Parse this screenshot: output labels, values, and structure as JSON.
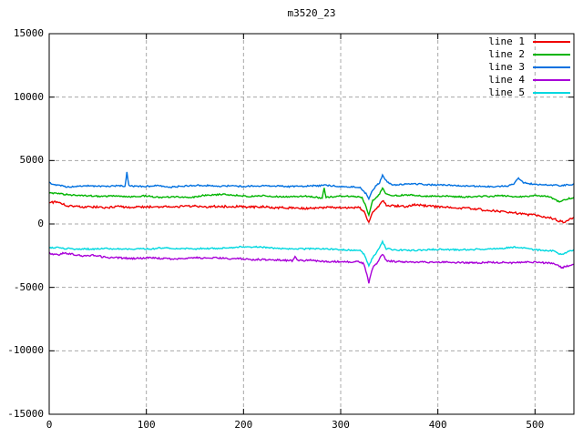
{
  "title": "m3520_23",
  "chart_data": {
    "type": "line",
    "title": "m3520_23",
    "xlabel": "",
    "ylabel": "",
    "xlim": [
      0,
      540
    ],
    "ylim": [
      -15000,
      15000
    ],
    "x_ticks": [
      0,
      100,
      200,
      300,
      400,
      500
    ],
    "x_tick_labels": [
      "0",
      "100",
      "200",
      "300",
      "400",
      "500"
    ],
    "y_ticks": [
      -15000,
      -10000,
      -5000,
      0,
      5000,
      10000,
      15000
    ],
    "y_tick_labels": [
      "-15000",
      "-10000",
      "-5000",
      "0",
      "5000",
      "10000",
      "15000"
    ],
    "grid": "dashed",
    "grid_color": "#a8a8a8",
    "border_color": "#000000",
    "background_color": "#ffffff",
    "legend_position": "top-right-inside",
    "series": [
      {
        "name": "line 1",
        "color": "#f00000",
        "noise": 110,
        "seed": 101,
        "anchors": [
          [
            0,
            1650
          ],
          [
            5,
            1750
          ],
          [
            9,
            1820
          ],
          [
            14,
            1600
          ],
          [
            20,
            1500
          ],
          [
            30,
            1420
          ],
          [
            40,
            1380
          ],
          [
            55,
            1350
          ],
          [
            70,
            1400
          ],
          [
            85,
            1380
          ],
          [
            100,
            1350
          ],
          [
            115,
            1400
          ],
          [
            130,
            1380
          ],
          [
            145,
            1420
          ],
          [
            160,
            1400
          ],
          [
            175,
            1450
          ],
          [
            190,
            1420
          ],
          [
            205,
            1380
          ],
          [
            220,
            1400
          ],
          [
            235,
            1350
          ],
          [
            250,
            1320
          ],
          [
            265,
            1300
          ],
          [
            280,
            1320
          ],
          [
            295,
            1350
          ],
          [
            310,
            1320
          ],
          [
            320,
            1280
          ],
          [
            325,
            900
          ],
          [
            329,
            100
          ],
          [
            333,
            1000
          ],
          [
            337,
            1250
          ],
          [
            340,
            1500
          ],
          [
            343,
            1900
          ],
          [
            347,
            1550
          ],
          [
            355,
            1450
          ],
          [
            365,
            1400
          ],
          [
            375,
            1450
          ],
          [
            385,
            1400
          ],
          [
            395,
            1350
          ],
          [
            405,
            1300
          ],
          [
            415,
            1250
          ],
          [
            425,
            1200
          ],
          [
            435,
            1150
          ],
          [
            445,
            1100
          ],
          [
            455,
            1050
          ],
          [
            465,
            1000
          ],
          [
            475,
            900
          ],
          [
            485,
            800
          ],
          [
            495,
            700
          ],
          [
            505,
            600
          ],
          [
            512,
            500
          ],
          [
            518,
            400
          ],
          [
            524,
            200
          ],
          [
            529,
            120
          ],
          [
            533,
            200
          ],
          [
            537,
            400
          ],
          [
            540,
            480
          ]
        ]
      },
      {
        "name": "line 2",
        "color": "#00b400",
        "noise": 70,
        "seed": 102,
        "anchors": [
          [
            0,
            2420
          ],
          [
            12,
            2350
          ],
          [
            25,
            2250
          ],
          [
            40,
            2200
          ],
          [
            55,
            2150
          ],
          [
            70,
            2200
          ],
          [
            85,
            2150
          ],
          [
            100,
            2220
          ],
          [
            115,
            2130
          ],
          [
            130,
            2180
          ],
          [
            145,
            2120
          ],
          [
            160,
            2250
          ],
          [
            175,
            2300
          ],
          [
            190,
            2250
          ],
          [
            205,
            2200
          ],
          [
            220,
            2250
          ],
          [
            235,
            2180
          ],
          [
            250,
            2150
          ],
          [
            265,
            2180
          ],
          [
            275,
            2100
          ],
          [
            281,
            2050
          ],
          [
            283,
            2880
          ],
          [
            285,
            2100
          ],
          [
            295,
            2180
          ],
          [
            305,
            2220
          ],
          [
            315,
            2150
          ],
          [
            322,
            2100
          ],
          [
            326,
            1400
          ],
          [
            329,
            700
          ],
          [
            333,
            1900
          ],
          [
            337,
            2100
          ],
          [
            340,
            2400
          ],
          [
            343,
            2850
          ],
          [
            347,
            2350
          ],
          [
            355,
            2250
          ],
          [
            365,
            2300
          ],
          [
            380,
            2250
          ],
          [
            395,
            2200
          ],
          [
            410,
            2180
          ],
          [
            425,
            2150
          ],
          [
            440,
            2200
          ],
          [
            455,
            2180
          ],
          [
            470,
            2220
          ],
          [
            480,
            2160
          ],
          [
            490,
            2200
          ],
          [
            500,
            2260
          ],
          [
            508,
            2220
          ],
          [
            515,
            2150
          ],
          [
            521,
            1900
          ],
          [
            526,
            1750
          ],
          [
            531,
            1950
          ],
          [
            536,
            2050
          ],
          [
            540,
            2100
          ]
        ]
      },
      {
        "name": "line 3",
        "color": "#0070e0",
        "noise": 70,
        "seed": 103,
        "anchors": [
          [
            0,
            3250
          ],
          [
            8,
            3100
          ],
          [
            20,
            2950
          ],
          [
            35,
            3050
          ],
          [
            50,
            2980
          ],
          [
            65,
            3000
          ],
          [
            78,
            3000
          ],
          [
            80,
            4100
          ],
          [
            82,
            3050
          ],
          [
            95,
            2980
          ],
          [
            110,
            3050
          ],
          [
            125,
            2900
          ],
          [
            140,
            3000
          ],
          [
            155,
            3050
          ],
          [
            170,
            2980
          ],
          [
            185,
            3020
          ],
          [
            200,
            3000
          ],
          [
            215,
            2960
          ],
          [
            230,
            3010
          ],
          [
            245,
            2950
          ],
          [
            260,
            3000
          ],
          [
            275,
            3040
          ],
          [
            283,
            3080
          ],
          [
            295,
            3000
          ],
          [
            310,
            2960
          ],
          [
            320,
            2870
          ],
          [
            326,
            2400
          ],
          [
            329,
            1950
          ],
          [
            332,
            2600
          ],
          [
            336,
            3000
          ],
          [
            340,
            3300
          ],
          [
            343,
            3900
          ],
          [
            347,
            3400
          ],
          [
            352,
            3150
          ],
          [
            360,
            3100
          ],
          [
            370,
            3200
          ],
          [
            385,
            3150
          ],
          [
            400,
            3100
          ],
          [
            415,
            3050
          ],
          [
            430,
            3000
          ],
          [
            445,
            2980
          ],
          [
            460,
            2950
          ],
          [
            470,
            3000
          ],
          [
            478,
            3150
          ],
          [
            483,
            3600
          ],
          [
            488,
            3250
          ],
          [
            495,
            3150
          ],
          [
            505,
            3100
          ],
          [
            515,
            3050
          ],
          [
            525,
            3000
          ],
          [
            533,
            3050
          ],
          [
            540,
            3120
          ]
        ]
      },
      {
        "name": "line 4",
        "color": "#a800d8",
        "noise": 85,
        "seed": 104,
        "anchors": [
          [
            0,
            -2300
          ],
          [
            8,
            -2480
          ],
          [
            15,
            -2350
          ],
          [
            25,
            -2420
          ],
          [
            35,
            -2550
          ],
          [
            45,
            -2480
          ],
          [
            55,
            -2600
          ],
          [
            70,
            -2650
          ],
          [
            85,
            -2700
          ],
          [
            100,
            -2620
          ],
          [
            115,
            -2680
          ],
          [
            130,
            -2720
          ],
          [
            145,
            -2650
          ],
          [
            160,
            -2620
          ],
          [
            175,
            -2680
          ],
          [
            190,
            -2720
          ],
          [
            205,
            -2780
          ],
          [
            220,
            -2820
          ],
          [
            235,
            -2880
          ],
          [
            250,
            -2900
          ],
          [
            253,
            -2550
          ],
          [
            256,
            -2880
          ],
          [
            265,
            -2850
          ],
          [
            280,
            -2900
          ],
          [
            295,
            -2920
          ],
          [
            310,
            -2950
          ],
          [
            318,
            -2900
          ],
          [
            324,
            -3100
          ],
          [
            329,
            -4600
          ],
          [
            333,
            -3400
          ],
          [
            337,
            -3050
          ],
          [
            340,
            -2700
          ],
          [
            343,
            -2350
          ],
          [
            347,
            -2850
          ],
          [
            355,
            -2950
          ],
          [
            370,
            -3000
          ],
          [
            385,
            -3020
          ],
          [
            400,
            -3050
          ],
          [
            415,
            -3080
          ],
          [
            430,
            -3100
          ],
          [
            445,
            -3060
          ],
          [
            460,
            -3050
          ],
          [
            475,
            -3080
          ],
          [
            490,
            -3040
          ],
          [
            500,
            -3060
          ],
          [
            510,
            -3090
          ],
          [
            518,
            -3120
          ],
          [
            524,
            -3300
          ],
          [
            528,
            -3500
          ],
          [
            533,
            -3350
          ],
          [
            537,
            -3250
          ],
          [
            540,
            -3220
          ]
        ]
      },
      {
        "name": "line 5",
        "color": "#00d8e0",
        "noise": 75,
        "seed": 105,
        "anchors": [
          [
            0,
            -1880
          ],
          [
            15,
            -1950
          ],
          [
            30,
            -2000
          ],
          [
            45,
            -1950
          ],
          [
            60,
            -1900
          ],
          [
            75,
            -1950
          ],
          [
            90,
            -1920
          ],
          [
            105,
            -1960
          ],
          [
            120,
            -1900
          ],
          [
            135,
            -1940
          ],
          [
            150,
            -1960
          ],
          [
            165,
            -1920
          ],
          [
            180,
            -1900
          ],
          [
            195,
            -1850
          ],
          [
            210,
            -1830
          ],
          [
            225,
            -1900
          ],
          [
            240,
            -1980
          ],
          [
            255,
            -1940
          ],
          [
            270,
            -1980
          ],
          [
            285,
            -2000
          ],
          [
            300,
            -2040
          ],
          [
            312,
            -2050
          ],
          [
            320,
            -2020
          ],
          [
            325,
            -2500
          ],
          [
            329,
            -3300
          ],
          [
            333,
            -2600
          ],
          [
            337,
            -2200
          ],
          [
            340,
            -1800
          ],
          [
            343,
            -1400
          ],
          [
            347,
            -1950
          ],
          [
            355,
            -2020
          ],
          [
            370,
            -2050
          ],
          [
            385,
            -2020
          ],
          [
            400,
            -2000
          ],
          [
            415,
            -2040
          ],
          [
            430,
            -2050
          ],
          [
            445,
            -2020
          ],
          [
            460,
            -1980
          ],
          [
            470,
            -1900
          ],
          [
            478,
            -1820
          ],
          [
            485,
            -1850
          ],
          [
            492,
            -1950
          ],
          [
            500,
            -2000
          ],
          [
            510,
            -2060
          ],
          [
            518,
            -2100
          ],
          [
            524,
            -2300
          ],
          [
            528,
            -2380
          ],
          [
            533,
            -2200
          ],
          [
            537,
            -2080
          ],
          [
            540,
            -2000
          ]
        ]
      }
    ]
  }
}
